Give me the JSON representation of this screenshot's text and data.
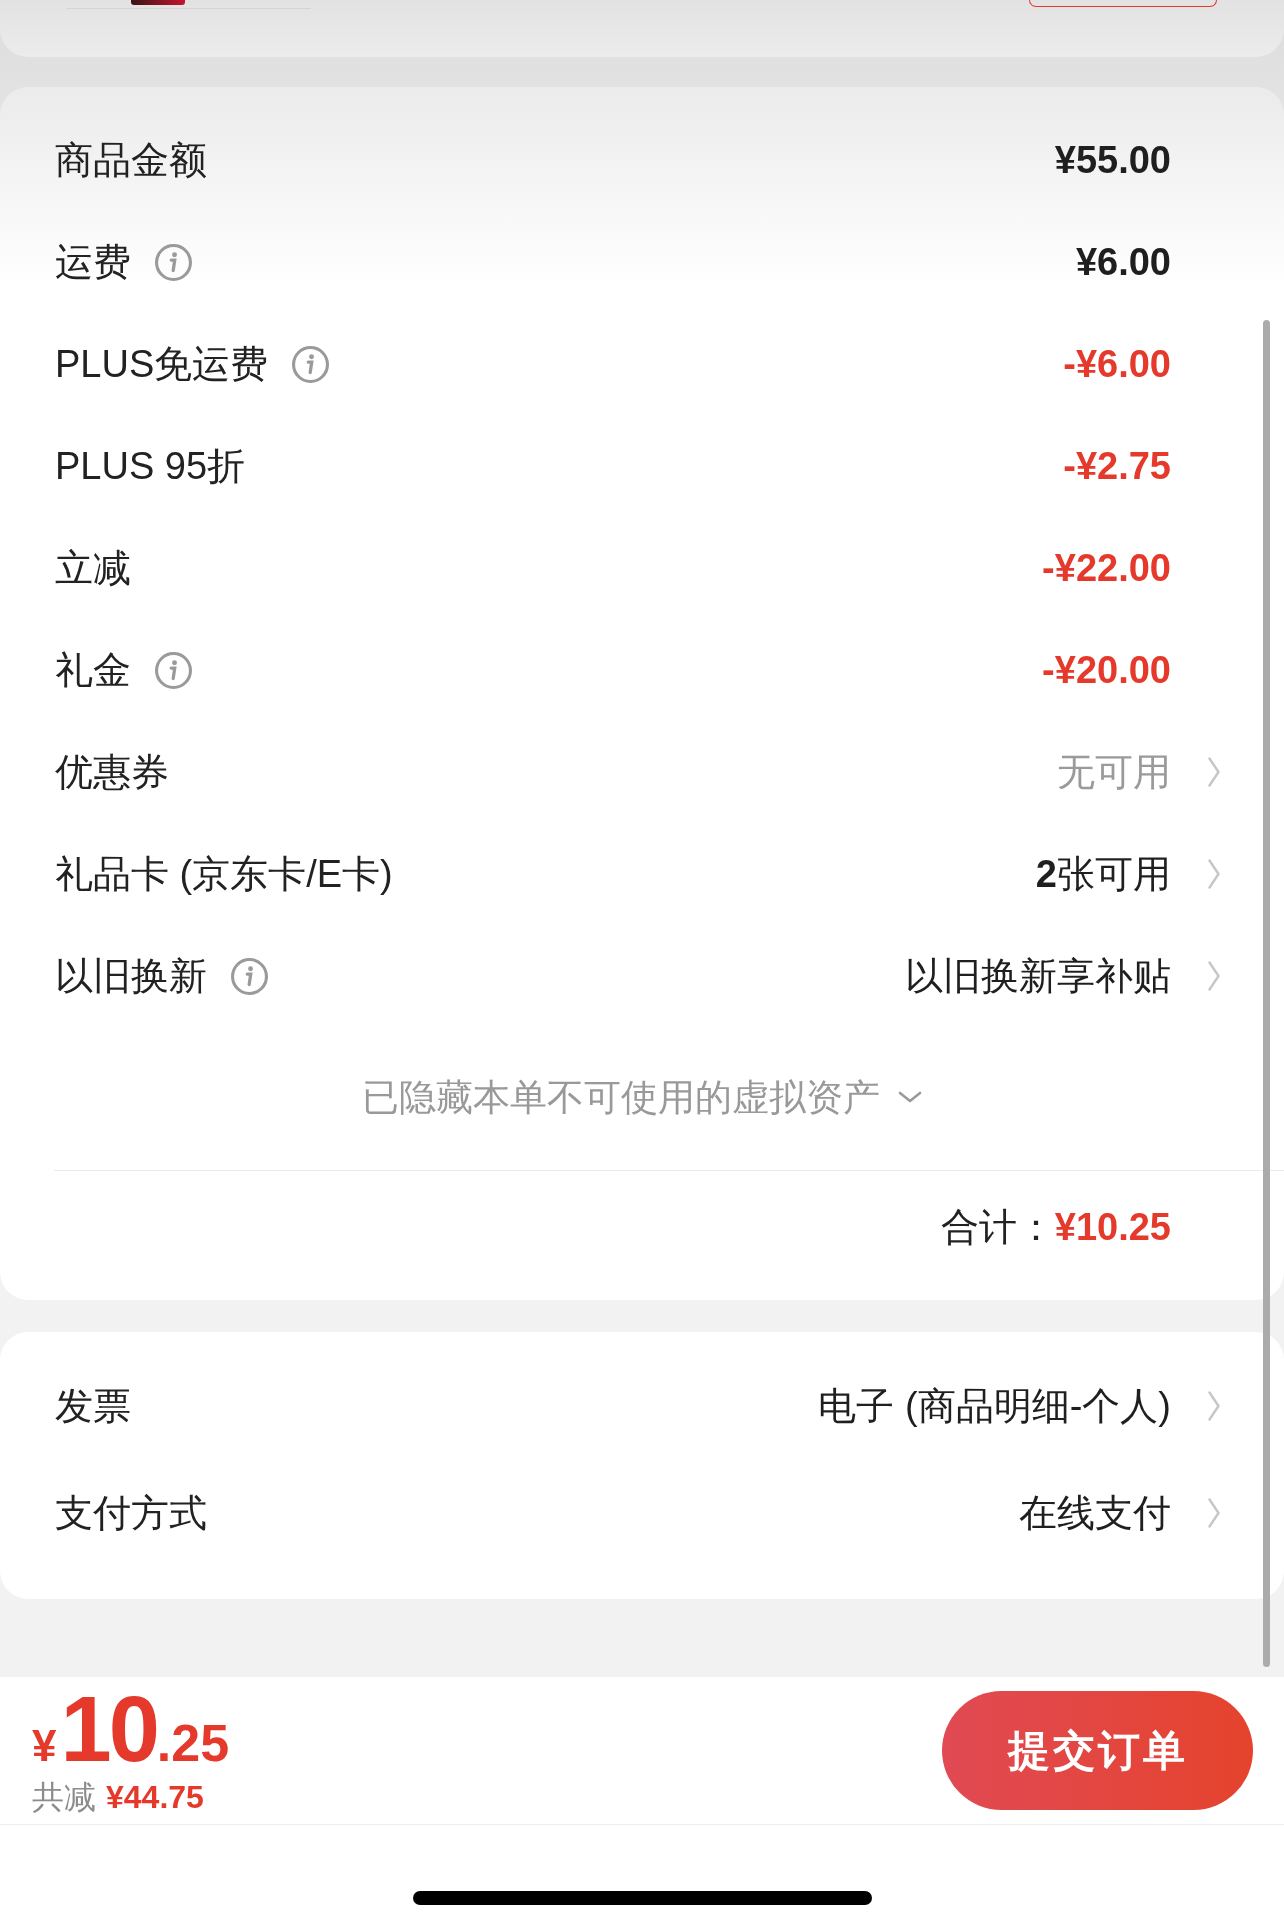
{
  "price_card": {
    "rows": [
      {
        "label": "商品金额",
        "info": false,
        "kind": "amount",
        "value": "¥55.00"
      },
      {
        "label": "运费",
        "info": true,
        "kind": "amount",
        "value": "¥6.00"
      },
      {
        "label": "PLUS免运费",
        "info": true,
        "kind": "discount",
        "value": "-¥6.00"
      },
      {
        "label": "PLUS 95折",
        "info": false,
        "kind": "discount",
        "value": "-¥2.75"
      },
      {
        "label": "立减",
        "info": false,
        "kind": "discount",
        "value": "-¥22.00"
      },
      {
        "label": "礼金",
        "info": true,
        "kind": "discount",
        "value": "-¥20.00"
      },
      {
        "label": "优惠券",
        "info": false,
        "kind": "option",
        "value": "无可用",
        "muted": true
      },
      {
        "label": "礼品卡 (京东卡/E卡)",
        "info": false,
        "kind": "option",
        "value": "**2**张可用",
        "muted": false
      },
      {
        "label": "以旧换新",
        "info": true,
        "kind": "option",
        "value": "以旧换新享补贴",
        "muted": false
      }
    ],
    "hidden_assets": {
      "text": "已隐藏本单不可使用的虚拟资产",
      "expanded": false
    },
    "total": {
      "label": "合计：",
      "value": "¥10.25"
    }
  },
  "options_card": {
    "rows": [
      {
        "label": "发票",
        "value": "电子 (商品明细-个人)"
      },
      {
        "label": "支付方式",
        "value": "在线支付"
      }
    ]
  },
  "checkout_bar": {
    "price": {
      "currency": "¥",
      "integer": "10",
      "fraction": ".25"
    },
    "savings_label": "共减",
    "savings_value": "¥44.75",
    "submit": "提交订单"
  }
}
